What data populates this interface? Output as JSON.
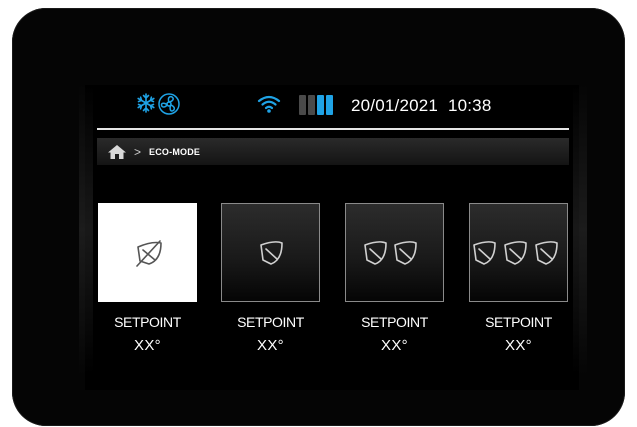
{
  "status_bar": {
    "icons": [
      "snowflake-icon",
      "fan-icon",
      "wifi-icon",
      "battery-icon"
    ],
    "date": "20/01/2021",
    "time": "10:38",
    "battery_segments": [
      "off",
      "off",
      "on",
      "on"
    ],
    "accent_color": "#1fa3e6"
  },
  "breadcrumb": {
    "home_icon": "home-icon",
    "separator": ">",
    "current": "ECO-MODE"
  },
  "modes": [
    {
      "icon": "eco-off-icon",
      "setpoint_label": "SETPOINT",
      "setpoint_value": "XX°",
      "selected": true
    },
    {
      "icon": "leaf-1-icon",
      "setpoint_label": "SETPOINT",
      "setpoint_value": "XX°",
      "selected": false
    },
    {
      "icon": "leaf-2-icon",
      "setpoint_label": "SETPOINT",
      "setpoint_value": "XX°",
      "selected": false
    },
    {
      "icon": "leaf-3-icon",
      "setpoint_label": "SETPOINT",
      "setpoint_value": "XX°",
      "selected": false
    }
  ]
}
